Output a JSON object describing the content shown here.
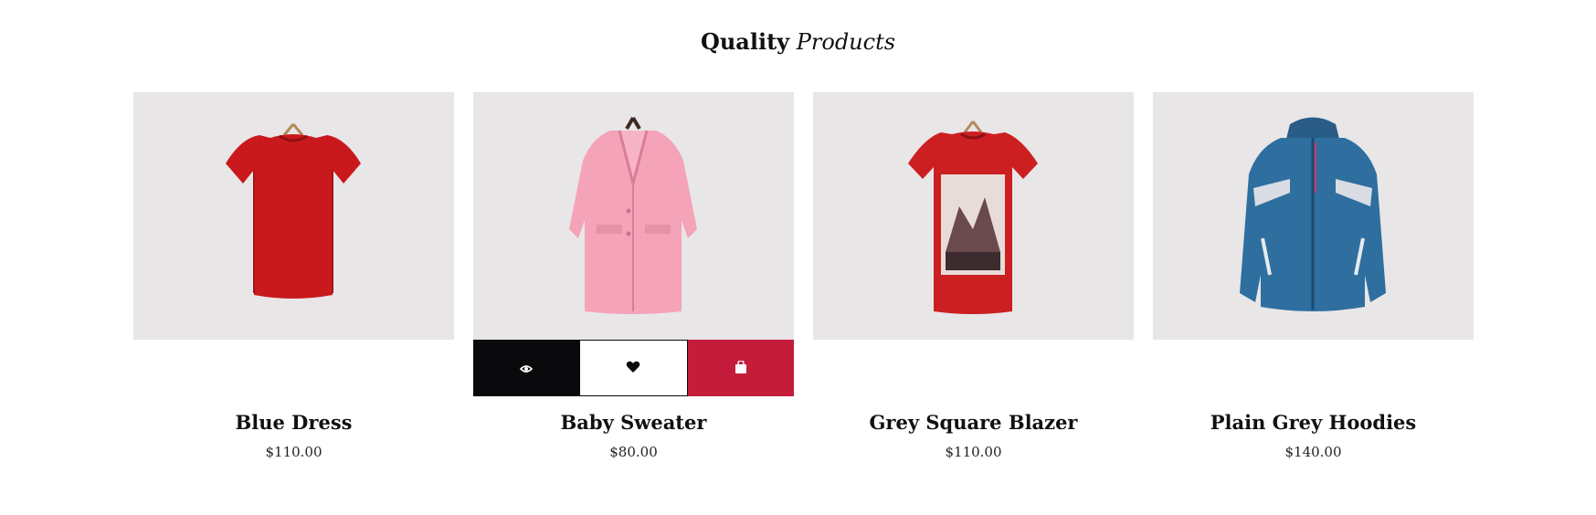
{
  "section": {
    "title_strong": "Quality",
    "title_em": "Products"
  },
  "colors": {
    "image_bg": "#e9e6e7",
    "view_button_bg": "#0a0a0c",
    "cart_button_bg": "#c41d3c"
  },
  "products": [
    {
      "name": "Blue Dress",
      "price": "$110.00",
      "image": "red-tshirt-on-hanger",
      "hover_actions_visible": false
    },
    {
      "name": "Baby Sweater",
      "price": "$80.00",
      "image": "pink-coat-on-hanger",
      "hover_actions_visible": true
    },
    {
      "name": "Grey Square Blazer",
      "price": "$110.00",
      "image": "red-graphic-tshirt-on-hanger",
      "hover_actions_visible": false
    },
    {
      "name": "Plain Grey Hoodies",
      "price": "$140.00",
      "image": "blue-ski-jacket",
      "hover_actions_visible": false
    }
  ],
  "actions": {
    "view_icon": "eye-icon",
    "wishlist_icon": "heart-icon",
    "cart_icon": "shopping-bag-icon"
  }
}
